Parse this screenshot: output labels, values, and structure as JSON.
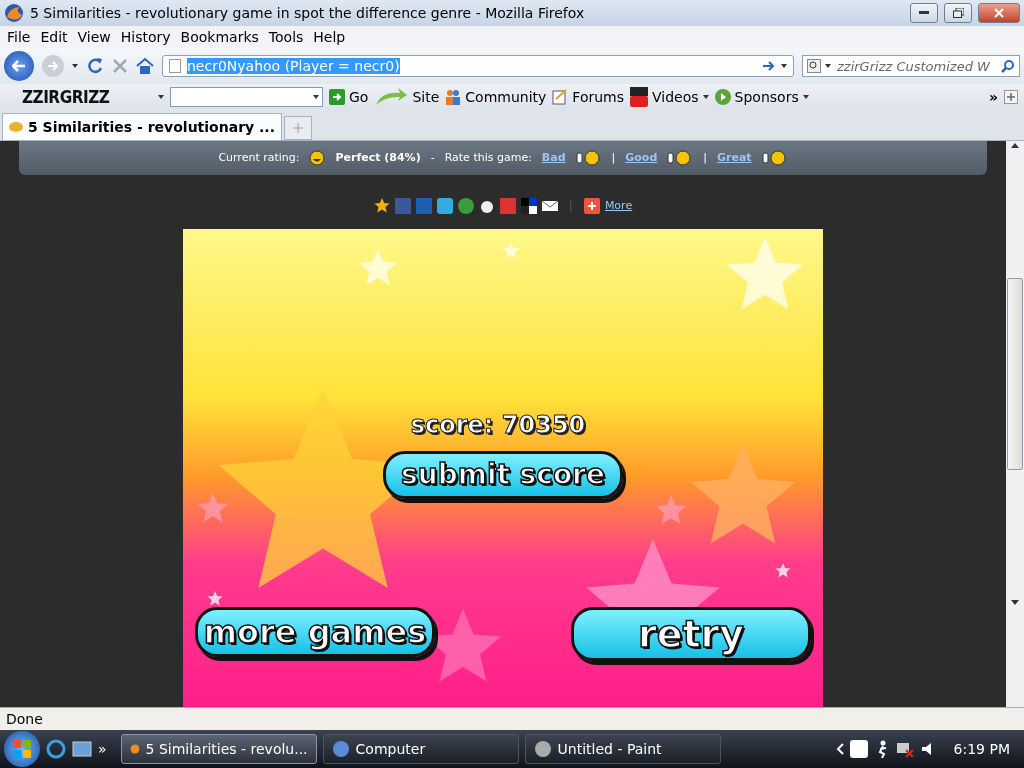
{
  "window": {
    "title": "5 Similarities - revolutionary game in spot the difference genre - Mozilla Firefox"
  },
  "menu": [
    "File",
    "Edit",
    "View",
    "History",
    "Bookmarks",
    "Tools",
    "Help"
  ],
  "navigation": {
    "address": "necr0Nyahoo (Player = necr0)",
    "address_selected": true,
    "search_placeholder": "zzirGrizz Customized W"
  },
  "bookmarks": {
    "logo": "ZZIRGRIZZ",
    "items": [
      {
        "kind": "go",
        "label": "Go"
      },
      {
        "kind": "site",
        "label": "Site"
      },
      {
        "kind": "community",
        "label": "Community"
      },
      {
        "kind": "forums",
        "label": "Forums"
      },
      {
        "kind": "videos",
        "label": "Videos"
      },
      {
        "kind": "sponsors",
        "label": "Sponsors"
      }
    ],
    "overflow": "»"
  },
  "tabs": [
    {
      "label": "5 Similarities - revolutionary ...",
      "selected": true
    }
  ],
  "rating": {
    "label": "Current rating:",
    "value": "Perfect (84%)",
    "dash": "-",
    "prompt": "Rate this game:",
    "options": [
      "Bad",
      "Good",
      "Great"
    ],
    "separators": [
      "|",
      "|"
    ]
  },
  "share": {
    "separator": "|",
    "more": "More"
  },
  "game": {
    "score": "score: 70350",
    "submit": "submit score",
    "more_games": "more games",
    "retry": "retry"
  },
  "status_bar": "Done",
  "taskbar": {
    "overflow": "»",
    "items": [
      {
        "label": "5 Similarities - revolu...",
        "selected": true
      },
      {
        "label": "Computer",
        "selected": false
      },
      {
        "label": "Untitled - Paint",
        "selected": false
      }
    ],
    "clock": "6:19 PM"
  }
}
